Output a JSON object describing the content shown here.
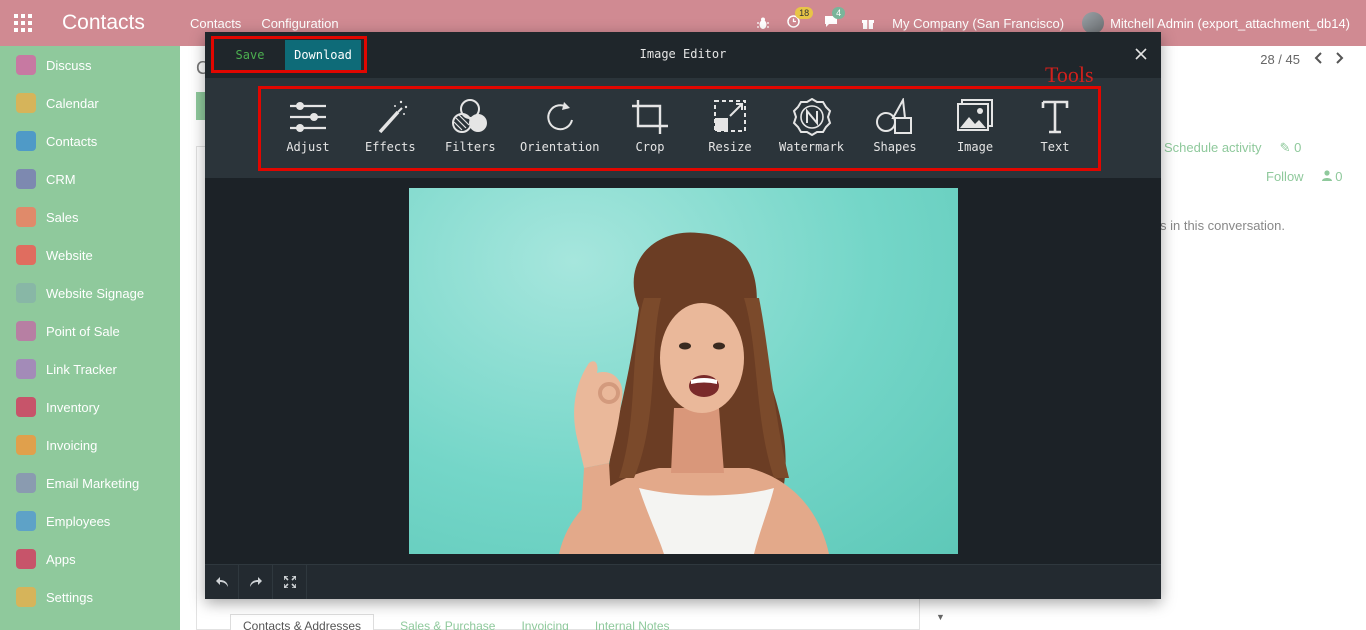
{
  "navbar": {
    "brand": "Contacts",
    "menu": [
      "Contacts",
      "Configuration"
    ],
    "activity_count": "18",
    "message_count": "4",
    "company": "My Company (San Francisco)",
    "user": "Mitchell Admin (export_attachment_db14)"
  },
  "sidebar": {
    "items": [
      {
        "label": "Discuss",
        "color": "#c779a2"
      },
      {
        "label": "Calendar",
        "color": "#d6b45a"
      },
      {
        "label": "Contacts",
        "color": "#4f9ac7"
      },
      {
        "label": "CRM",
        "color": "#7d89b0"
      },
      {
        "label": "Sales",
        "color": "#e08a6a"
      },
      {
        "label": "Website",
        "color": "#e06d5f"
      },
      {
        "label": "Website Signage",
        "color": "#88b7a6"
      },
      {
        "label": "Point of Sale",
        "color": "#b77fa3"
      },
      {
        "label": "Link Tracker",
        "color": "#a38bb8"
      },
      {
        "label": "Inventory",
        "color": "#c7546a"
      },
      {
        "label": "Invoicing",
        "color": "#e0a04c"
      },
      {
        "label": "Email Marketing",
        "color": "#8a9bb0"
      },
      {
        "label": "Employees",
        "color": "#5ea2c7"
      },
      {
        "label": "Apps",
        "color": "#c7546a"
      },
      {
        "label": "Settings",
        "color": "#d6b45a"
      }
    ]
  },
  "background": {
    "pager": "28 / 45",
    "schedule_activity": "Schedule activity",
    "attachments": "0",
    "follow": "Follow",
    "followers": "0",
    "conversation_note": "s in this conversation.",
    "tabs": [
      "Contacts & Addresses",
      "Sales & Purchase",
      "Invoicing",
      "Internal Notes"
    ]
  },
  "editor": {
    "title": "Image Editor",
    "save_label": "Save",
    "download_label": "Download",
    "annotation": "Tools",
    "tools": [
      "Adjust",
      "Effects",
      "Filters",
      "Orientation",
      "Crop",
      "Resize",
      "Watermark",
      "Shapes",
      "Image",
      "Text"
    ]
  }
}
